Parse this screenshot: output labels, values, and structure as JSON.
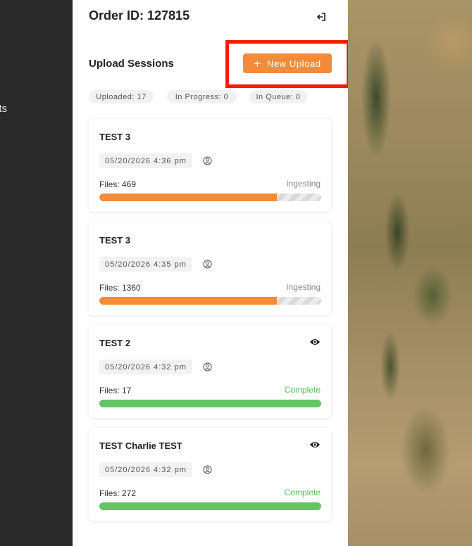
{
  "nav": {
    "partial_label": "nts"
  },
  "header": {
    "order_title": "Order ID: 127815"
  },
  "section": {
    "title": "Upload Sessions",
    "new_upload_label": "New Upload"
  },
  "stats": {
    "uploaded": "Uploaded: 17",
    "in_progress": "In Progress: 0",
    "in_queue": "In Queue: 0"
  },
  "sessions": [
    {
      "title": "TEST 3",
      "date": "05/20/2026 4:36 pm",
      "files": "Files: 469",
      "status": "Ingesting",
      "progress": 0.8,
      "has_view": false
    },
    {
      "title": "TEST 3",
      "date": "05/20/2026 4:35 pm",
      "files": "Files: 1360",
      "status": "Ingesting",
      "progress": 0.8,
      "has_view": false
    },
    {
      "title": "TEST 2",
      "date": "05/20/2026 4:32 pm",
      "files": "Files: 17",
      "status": "Complete",
      "progress": 1.0,
      "has_view": true
    },
    {
      "title": "TEST Charlie TEST",
      "date": "05/20/2026 4:32 pm",
      "files": "Files: 272",
      "status": "Complete",
      "progress": 1.0,
      "has_view": true
    }
  ],
  "colors": {
    "accent": "#f28c38",
    "complete": "#65c466",
    "highlight": "#ff1a00",
    "sidebar": "#2a2a2a"
  },
  "icons": {
    "logout": "logout-icon",
    "view": "eye-icon",
    "user": "user-icon",
    "add": "plus-icon"
  }
}
